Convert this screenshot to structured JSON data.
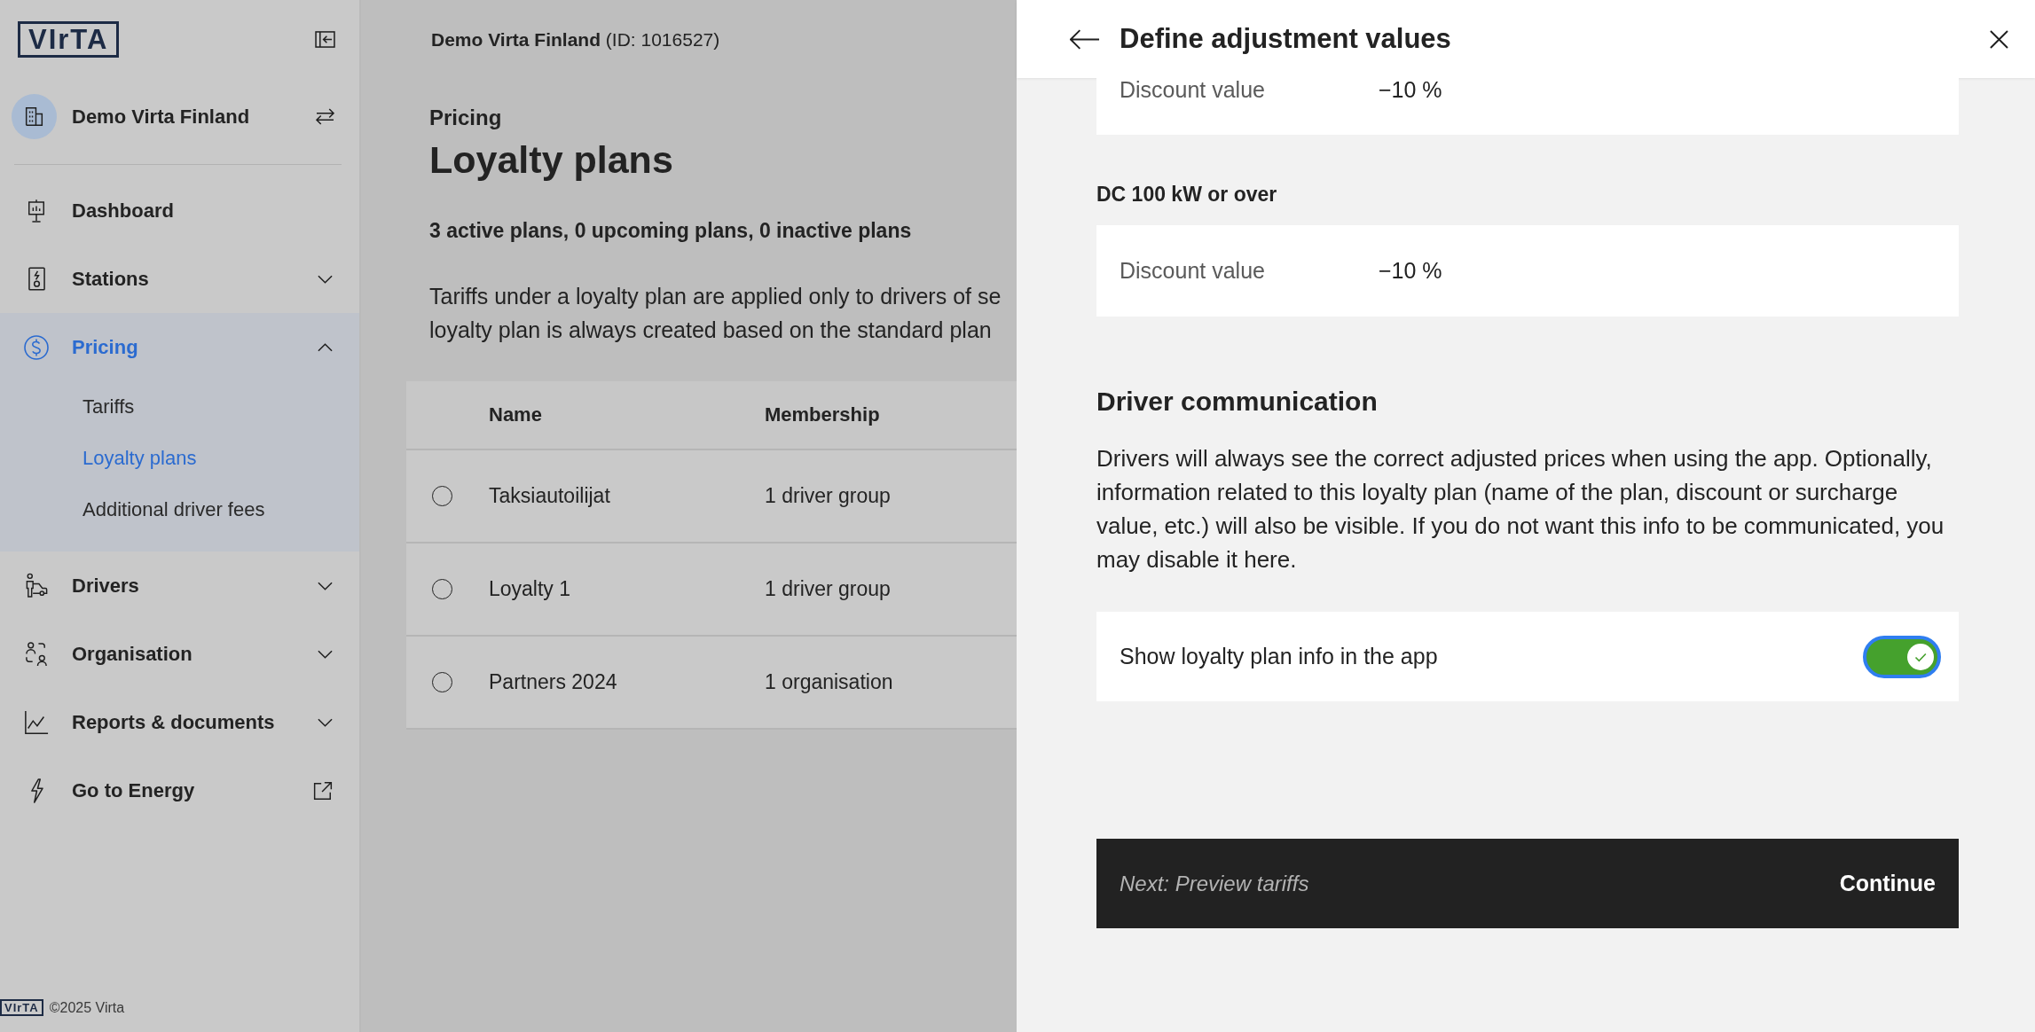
{
  "sidebar": {
    "logo": "VIrTA",
    "organisation": "Demo Virta Finland",
    "nav": [
      {
        "label": "Dashboard",
        "kind": "link",
        "selected": false
      },
      {
        "label": "Stations",
        "kind": "group",
        "expanded": false,
        "selected": false
      },
      {
        "label": "Pricing",
        "kind": "group",
        "expanded": true,
        "selected": true,
        "children": [
          {
            "label": "Tariffs",
            "selected": false
          },
          {
            "label": "Loyalty plans",
            "selected": true
          },
          {
            "label": "Additional driver fees",
            "selected": false
          }
        ]
      },
      {
        "label": "Drivers",
        "kind": "group",
        "expanded": false,
        "selected": false
      },
      {
        "label": "Organisation",
        "kind": "group",
        "expanded": false,
        "selected": false
      },
      {
        "label": "Reports & documents",
        "kind": "group",
        "expanded": false,
        "selected": false
      },
      {
        "label": "Go to Energy",
        "kind": "external",
        "selected": false
      }
    ],
    "footer": {
      "logo": "VIrTA",
      "copyright": "©2025 Virta"
    }
  },
  "main": {
    "header": "**Demo Virta Finland** (ID: 1016527)",
    "breadcrumb": "Pricing",
    "title": "Loyalty plans",
    "summary": "3 active plans, 0 upcoming plans, 0 inactive plans",
    "description": [
      "Tariffs under a loyalty plan are applied only to drivers of se",
      "loyalty plan is always created based on the standard plan"
    ],
    "table": {
      "columns": [
        "Name",
        "Membership"
      ],
      "rows": [
        {
          "selected": false,
          "name": "Taksiautoilijat",
          "membership": "1 driver group"
        },
        {
          "selected": false,
          "name": "Loyalty 1",
          "membership": "1 driver group"
        },
        {
          "selected": false,
          "name": "Partners 2024",
          "membership": "1 organisation"
        }
      ]
    }
  },
  "panel": {
    "title": "Define adjustment values",
    "adjustments": [
      {
        "label": "Discount value",
        "value": "−10 %"
      },
      {
        "heading": "DC 100 kW or over",
        "label": "Discount value",
        "value": "−10 %"
      }
    ],
    "communication": {
      "heading": "Driver communication",
      "text": [
        "Drivers will always see the correct adjusted prices when using the app. Optionally,",
        "information related to this loyalty plan (name of the plan, discount or surcharge",
        "value, etc.) will also be visible. If you do not want this info to be communicated, you",
        "may disable it here."
      ],
      "toggle": {
        "label": "Show loyalty plan info in the app",
        "on": true,
        "focused": true
      }
    },
    "footer": {
      "next": "Next: Preview tariffs",
      "button": "Continue"
    }
  }
}
